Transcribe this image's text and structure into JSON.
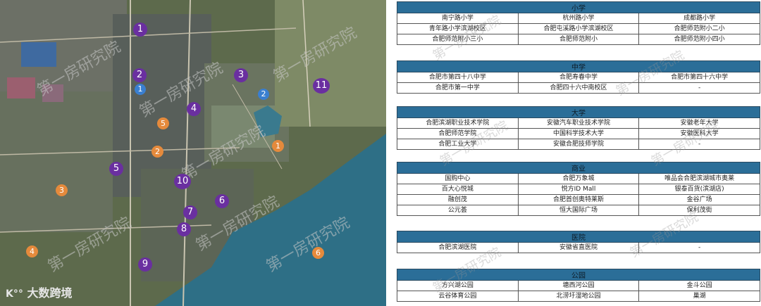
{
  "map": {
    "logo": "大数跨境",
    "watermark": "第一房研究院",
    "pins": [
      {
        "n": "1",
        "color": "#6a2fa0"
      },
      {
        "n": "2",
        "color": "#6a2fa0"
      },
      {
        "n": "3",
        "color": "#6a2fa0"
      },
      {
        "n": "4",
        "color": "#6a2fa0"
      },
      {
        "n": "5",
        "color": "#6a2fa0"
      },
      {
        "n": "6",
        "color": "#6a2fa0"
      },
      {
        "n": "7",
        "color": "#6a2fa0"
      },
      {
        "n": "8",
        "color": "#6a2fa0"
      },
      {
        "n": "9",
        "color": "#6a2fa0"
      },
      {
        "n": "10",
        "color": "#6a2fa0"
      },
      {
        "n": "11",
        "color": "#6a2fa0"
      },
      {
        "n": "1",
        "color": "#3a7fd0"
      },
      {
        "n": "2",
        "color": "#3a7fd0"
      },
      {
        "n": "1",
        "color": "#e58a3c"
      },
      {
        "n": "2",
        "color": "#e58a3c"
      },
      {
        "n": "3",
        "color": "#e58a3c"
      },
      {
        "n": "4",
        "color": "#e58a3c"
      },
      {
        "n": "5",
        "color": "#e58a3c"
      },
      {
        "n": "6",
        "color": "#e58a3c"
      }
    ]
  },
  "tables": [
    {
      "title": "小学",
      "rows": [
        [
          "南宁路小学",
          "杭州路小学",
          "成都路小学"
        ],
        [
          "青年路小学滨湖校区",
          "合肥屯溪路小学滨湖校区",
          "合肥师范附小二小"
        ],
        [
          "合肥师范附小三小",
          "合肥师范附小",
          "合肥师范附小四小"
        ]
      ]
    },
    {
      "title": "中学",
      "rows": [
        [
          "合肥市第四十八中学",
          "合肥寿春中学",
          "合肥市第四十六中学"
        ],
        [
          "合肥市第一中学",
          "合肥四十六中南校区",
          "-"
        ]
      ]
    },
    {
      "title": "大学",
      "rows": [
        [
          "合肥滨湖职业技术学院",
          "安徽汽车职业技术学院",
          "安徽老年大学"
        ],
        [
          "合肥师范学院",
          "中国科学技术大学",
          "安徽医科大学"
        ],
        [
          "合肥工业大学",
          "安徽合肥技师学院",
          "-"
        ]
      ]
    },
    {
      "title": "商业",
      "rows": [
        [
          "国购中心",
          "合肥万象城",
          "唯品会合肥滨湖城市奥莱"
        ],
        [
          "百大心悦城",
          "悦方ID Mall",
          "银泰百货(滨湖店)"
        ],
        [
          "融创茂",
          "合肥首创奥特莱斯",
          "金谷广场"
        ],
        [
          "公元荟",
          "恒大国际广场",
          "保利茂街"
        ]
      ]
    },
    {
      "title": "医院",
      "rows": [
        [
          "合肥滨湖医院",
          "安徽省直医院",
          "-"
        ]
      ]
    },
    {
      "title": "公园",
      "rows": [
        [
          "方兴湖公园",
          "塘西河公园",
          "金斗公园"
        ],
        [
          "云谷体育公园",
          "北涝圩湿地公园",
          "巢湖"
        ]
      ]
    }
  ]
}
